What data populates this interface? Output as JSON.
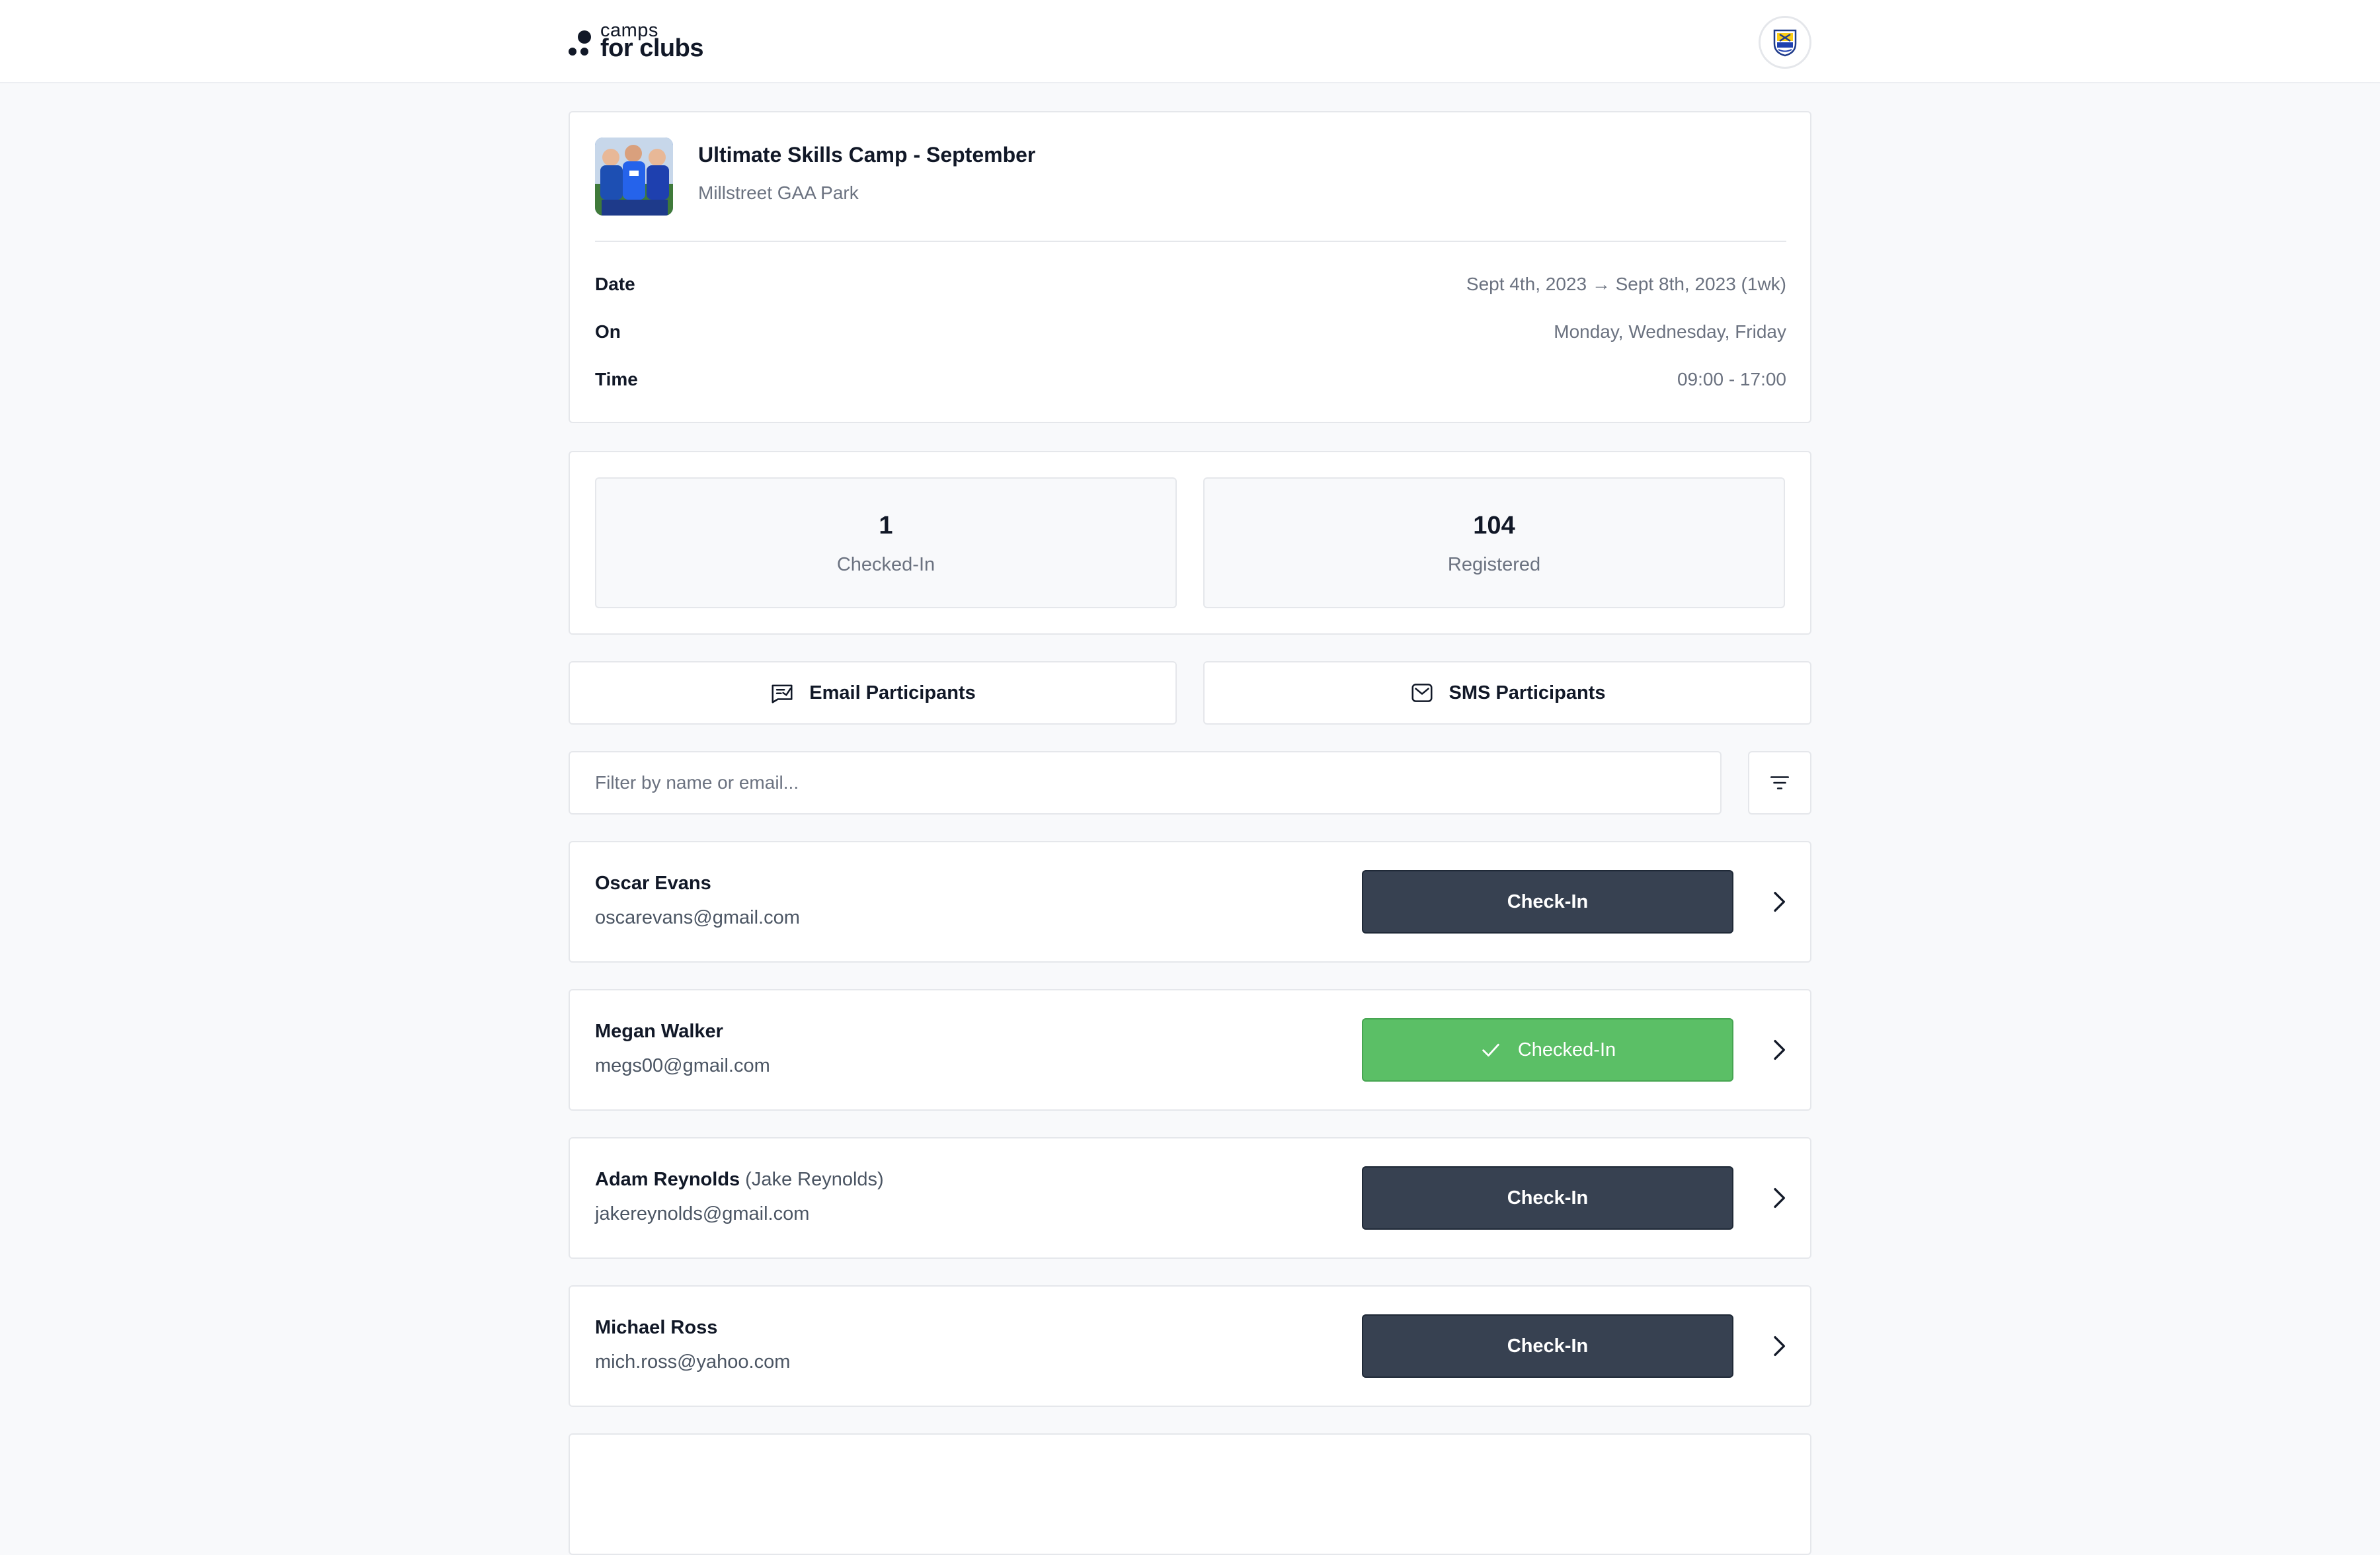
{
  "header": {
    "logo_top": "camps",
    "logo_bottom": "for clubs"
  },
  "camp": {
    "title": "Ultimate Skills Camp - September",
    "venue": "Millstreet GAA Park",
    "details": [
      {
        "label": "Date",
        "value": "Sept 4th, 2023 → Sept 8th, 2023 (1wk)"
      },
      {
        "label": "On",
        "value": "Monday, Wednesday, Friday"
      },
      {
        "label": "Time",
        "value": "09:00 - 17:00"
      }
    ]
  },
  "stats": {
    "checked_in": {
      "count": "1",
      "label": "Checked-In"
    },
    "registered": {
      "count": "104",
      "label": "Registered"
    }
  },
  "actions": {
    "email_label": "Email Participants",
    "sms_label": "SMS Participants"
  },
  "filter": {
    "placeholder": "Filter by name or email..."
  },
  "participants": [
    {
      "name": "Oscar Evans",
      "guardian": "",
      "email": "oscarevans@gmail.com",
      "button": "Check-In",
      "checked_in": false
    },
    {
      "name": "Megan Walker",
      "guardian": "",
      "email": "megs00@gmail.com",
      "button": "Checked-In",
      "checked_in": true
    },
    {
      "name": "Adam Reynolds",
      "guardian": "(Jake Reynolds)",
      "email": "jakereynolds@gmail.com",
      "button": "Check-In",
      "checked_in": false
    },
    {
      "name": "Michael Ross",
      "guardian": "",
      "email": "mich.ross@yahoo.com",
      "button": "Check-In",
      "checked_in": false
    }
  ],
  "colors": {
    "page_bg": "#f8f9fb",
    "button_dark": "#374151",
    "checked_green": "#5bbf66",
    "border": "#e5e7eb",
    "muted_text": "#6b7280"
  },
  "icons": {
    "email": "email-chat-icon",
    "sms": "envelope-icon",
    "filter": "filter-lines-icon",
    "row_nav": "chevron-right-icon",
    "checked": "check-icon"
  }
}
